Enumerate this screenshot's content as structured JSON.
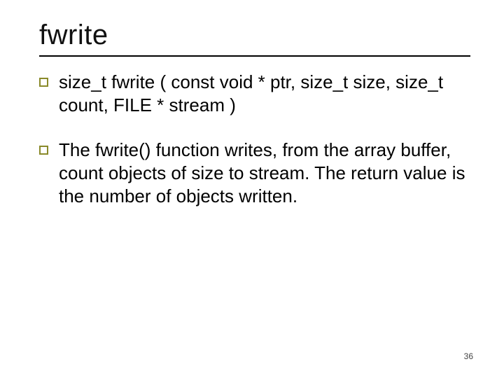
{
  "title": "fwrite",
  "bullets": [
    "size_t fwrite ( const void * ptr, size_t size, size_t count, FILE * stream )",
    "The fwrite() function writes, from the array buffer, count objects of size to stream. The return value is the number of objects written."
  ],
  "page_number": "36",
  "colors": {
    "bullet_border": "#8a8a2a",
    "rule": "#000000"
  }
}
